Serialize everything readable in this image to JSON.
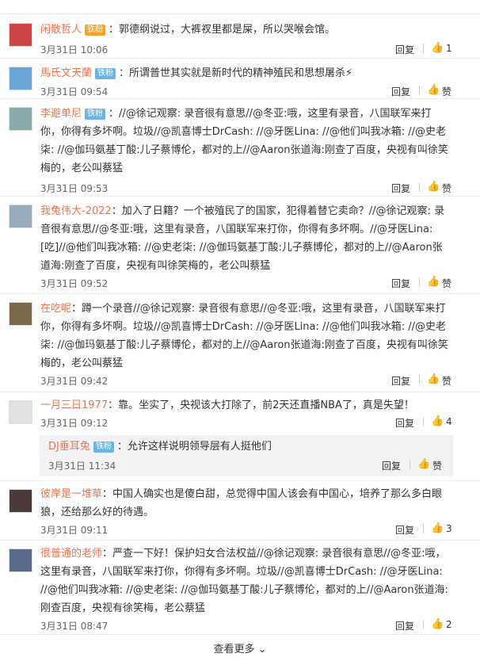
{
  "comments": [
    {
      "user": "闲散哲人",
      "badge": "铁粉",
      "sep": "：",
      "text": "郭德纲说过，大裤衩里都是屎，所以哭喉会馆。",
      "time": "3月31日 10:06",
      "reply": "回复",
      "likes": "1"
    },
    {
      "user": "馬氏文天蘭",
      "badge": "铁粉",
      "sep": "：",
      "text": "所谓普世其实就是新时代的精神殖民和思想屠杀⚡",
      "time": "3月31日 09:54",
      "reply": "回复",
      "likes": "赞"
    },
    {
      "user": "李避单尼",
      "badge": "铁粉",
      "sep": "：",
      "text": "//@徐记观察:  录音很有意思//@冬亚:哦，这里有录音，八国联军来打你，你得有多坏啊。垃圾//@凯喜博士DrCash:  //@牙医Lina:  //@他们叫我冰箱:  //@史老柒:  //@伽玛氨基丁酸:儿子蔡博伦，都对的上//@Aaron张道海:刚查了百度，央视有叫徐笑梅的，老公叫蔡猛",
      "time": "3月31日 09:53",
      "reply": "回复",
      "likes": "赞"
    },
    {
      "user": "我兔伟大-2022",
      "badge": "",
      "sep": "：",
      "text": "加入了日籍？一个被殖民了的国家，犯得着替它卖命？//@徐记观察:  录音很有意思//@冬亚:哦，这里有录音，八国联军来打你，你得有多坏啊。//@牙医Lina: [吃]//@他们叫我冰箱:  //@史老柒:  //@伽玛氨基丁酸:儿子蔡博伦，都对的上//@Aaron张道海:刚查了百度，央视有叫徐笑梅的，老公叫蔡猛",
      "time": "3月31日 09:52",
      "reply": "回复",
      "likes": "赞"
    },
    {
      "user": "在吃呢",
      "badge": "",
      "sep": "：",
      "text": "蹲一个录音//@徐记观察:  录音很有意思//@冬亚:哦，这里有录音，八国联军来打你，你得有多坏啊。垃圾//@凯喜博士DrCash:  //@牙医Lina:  //@他们叫我冰箱:  //@史老柒:  //@伽玛氨基丁酸:儿子蔡博伦，都对的上//@Aaron张道海:刚查了百度，央视有叫徐笑梅的，老公叫蔡猛",
      "time": "3月31日 09:42",
      "reply": "回复",
      "likes": "赞"
    },
    {
      "user": "一月三日1977",
      "badge": "",
      "sep": "：",
      "text": "靠。坐实了，央视该大打除了，前2天还直播NBA了，真是失望！",
      "time": "3月31日 09:12",
      "reply": "回复",
      "likes": "4"
    },
    {
      "user": "彼岸是一堆草",
      "badge": "",
      "sep": "：",
      "text": "中国人确实也是傻白甜，总觉得中国人该会有中国心，培养了那么多白眼狼，还给那么好的待遇。",
      "time": "3月31日 09:11",
      "reply": "回复",
      "likes": "3"
    },
    {
      "user": "很普通的老师",
      "badge": "",
      "sep": "：",
      "text": "严查一下好！保护妇女合法权益//@徐记观察:  录音很有意思//@冬亚:哦，这里有录音，八国联军来打你，你得有多坏啊。垃圾//@凯喜博士DrCash:  //@牙医Lina:  //@他们叫我冰箱:  //@史老柒:  //@伽玛氨基丁酸:儿子蔡博伦，都对的上//@Aaron张道海:刚查百度，央视有徐笑梅，老公蔡猛",
      "time": "3月31日 08:47",
      "reply": "回复",
      "likes": "2"
    }
  ],
  "subreply": {
    "user": "DJ垂耳兔",
    "badge": "铁粉",
    "sep": "：",
    "text": "允许这样说明领导层有人挺他们",
    "time": "3月31日 11:34",
    "reply": "回复",
    "likes": "赞"
  },
  "more_label": "查看更多",
  "colors": {
    "username": "#eb7350",
    "badge": "#69b4e6",
    "badge_gold": "#f5a623",
    "subreply_bg": "#f2f2f5"
  }
}
